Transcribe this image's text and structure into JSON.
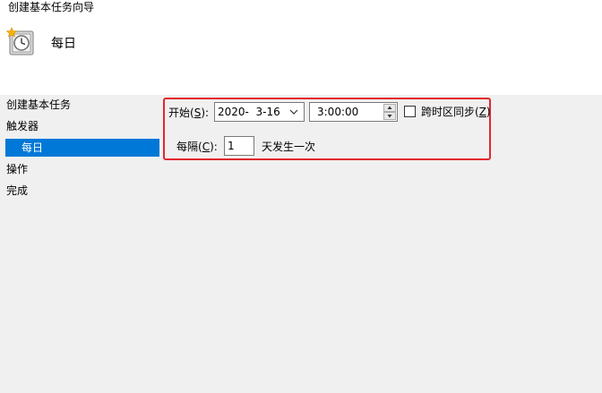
{
  "window": {
    "title": "创建基本任务向导"
  },
  "header": {
    "icon": "clock-task-icon",
    "title": "每日"
  },
  "sidebar": {
    "items": [
      {
        "label": "创建基本任务",
        "selected": false
      },
      {
        "label": "触发器",
        "selected": false
      },
      {
        "label": "每日",
        "selected": true
      },
      {
        "label": "操作",
        "selected": false
      },
      {
        "label": "完成",
        "selected": false
      }
    ]
  },
  "form": {
    "start_label": "开始(",
    "start_mnemonic": "S",
    "start_label_end": "):",
    "start_date": "2020-  3-16",
    "start_time": "3:00:00",
    "sync_tz_label": "跨时区同步(",
    "sync_tz_mnemonic": "Z",
    "sync_tz_label_end": ")",
    "sync_tz_checked": false,
    "every_label": "每隔(",
    "every_mnemonic": "C",
    "every_label_end": "):",
    "every_value": "1",
    "every_suffix": "天发生一次"
  },
  "colors": {
    "selection": "#0078d7",
    "panel_bg": "#f0f0f0",
    "highlight_border": "#e3262e"
  }
}
